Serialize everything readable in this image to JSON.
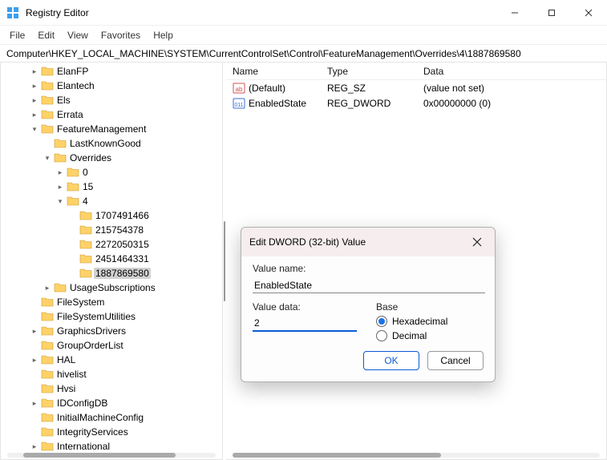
{
  "app": {
    "title": "Registry Editor"
  },
  "menu": {
    "file": "File",
    "edit": "Edit",
    "view": "View",
    "favorites": "Favorites",
    "help": "Help"
  },
  "address": "Computer\\HKEY_LOCAL_MACHINE\\SYSTEM\\CurrentControlSet\\Control\\FeatureManagement\\Overrides\\4\\1887869580",
  "tree": {
    "items": [
      {
        "indent": 2,
        "chev": "right",
        "label": "ElanFP"
      },
      {
        "indent": 2,
        "chev": "right",
        "label": "Elantech"
      },
      {
        "indent": 2,
        "chev": "right",
        "label": "Els"
      },
      {
        "indent": 2,
        "chev": "right",
        "label": "Errata"
      },
      {
        "indent": 2,
        "chev": "down",
        "label": "FeatureManagement"
      },
      {
        "indent": 3,
        "chev": "",
        "label": "LastKnownGood"
      },
      {
        "indent": 3,
        "chev": "down",
        "label": "Overrides"
      },
      {
        "indent": 4,
        "chev": "right",
        "label": "0"
      },
      {
        "indent": 4,
        "chev": "right",
        "label": "15"
      },
      {
        "indent": 4,
        "chev": "down",
        "label": "4"
      },
      {
        "indent": 5,
        "chev": "",
        "label": "1707491466"
      },
      {
        "indent": 5,
        "chev": "",
        "label": "215754378"
      },
      {
        "indent": 5,
        "chev": "",
        "label": "2272050315"
      },
      {
        "indent": 5,
        "chev": "",
        "label": "2451464331"
      },
      {
        "indent": 5,
        "chev": "",
        "label": "1887869580",
        "selected": true
      },
      {
        "indent": 3,
        "chev": "right",
        "label": "UsageSubscriptions"
      },
      {
        "indent": 2,
        "chev": "",
        "label": "FileSystem"
      },
      {
        "indent": 2,
        "chev": "",
        "label": "FileSystemUtilities"
      },
      {
        "indent": 2,
        "chev": "right",
        "label": "GraphicsDrivers"
      },
      {
        "indent": 2,
        "chev": "",
        "label": "GroupOrderList"
      },
      {
        "indent": 2,
        "chev": "right",
        "label": "HAL"
      },
      {
        "indent": 2,
        "chev": "",
        "label": "hivelist"
      },
      {
        "indent": 2,
        "chev": "",
        "label": "Hvsi"
      },
      {
        "indent": 2,
        "chev": "right",
        "label": "IDConfigDB"
      },
      {
        "indent": 2,
        "chev": "",
        "label": "InitialMachineConfig"
      },
      {
        "indent": 2,
        "chev": "",
        "label": "IntegrityServices"
      },
      {
        "indent": 2,
        "chev": "right",
        "label": "International"
      }
    ]
  },
  "list": {
    "cols": {
      "name": "Name",
      "type": "Type",
      "data": "Data"
    },
    "rows": [
      {
        "icon": "str",
        "name": "(Default)",
        "type": "REG_SZ",
        "data": "(value not set)"
      },
      {
        "icon": "bin",
        "name": "EnabledState",
        "type": "REG_DWORD",
        "data": "0x00000000 (0)"
      }
    ]
  },
  "dialog": {
    "title": "Edit DWORD (32-bit) Value",
    "value_name_label": "Value name:",
    "value_name": "EnabledState",
    "value_data_label": "Value data:",
    "value_data": "2",
    "base_label": "Base",
    "hex_label": "Hexadecimal",
    "dec_label": "Decimal",
    "ok": "OK",
    "cancel": "Cancel"
  }
}
